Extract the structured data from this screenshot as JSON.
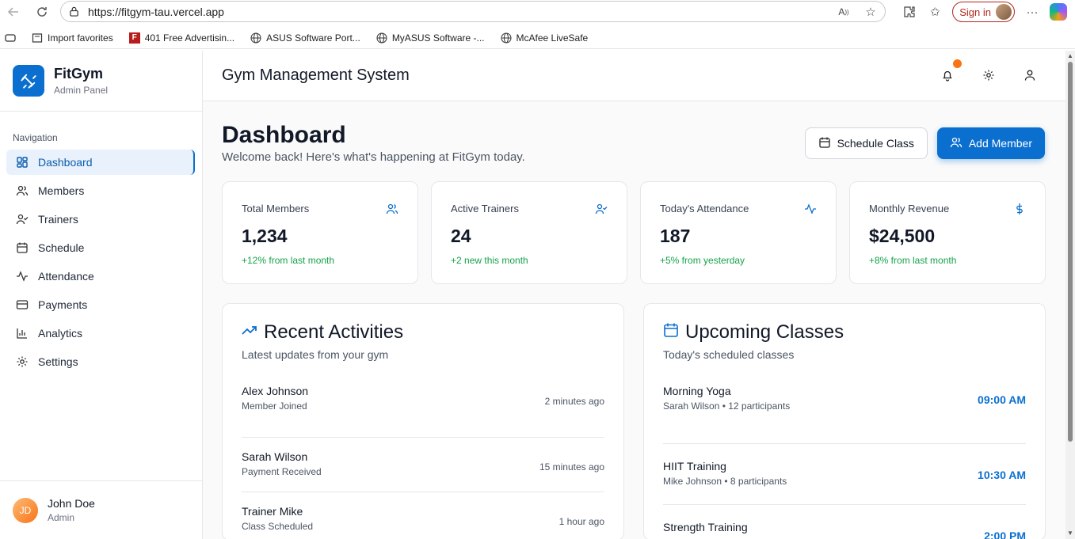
{
  "browser": {
    "url": "https://fitgym-tau.vercel.app",
    "signin_label": "Sign in",
    "bookmarks": [
      {
        "label": "Import favorites",
        "icon": "folder-icon"
      },
      {
        "label": "401 Free Advertisin...",
        "icon": "f-logo-icon"
      },
      {
        "label": "ASUS Software Port...",
        "icon": "globe-icon"
      },
      {
        "label": "MyASUS Software -...",
        "icon": "globe-icon"
      },
      {
        "label": "McAfee LiveSafe",
        "icon": "globe-icon"
      }
    ]
  },
  "brand": {
    "name": "FitGym",
    "subtitle": "Admin Panel",
    "color": "#0a6fcf"
  },
  "sidebar": {
    "title": "Navigation",
    "items": [
      {
        "label": "Dashboard",
        "icon": "grid-icon",
        "active": true
      },
      {
        "label": "Members",
        "icon": "users-icon"
      },
      {
        "label": "Trainers",
        "icon": "user-check-icon"
      },
      {
        "label": "Schedule",
        "icon": "calendar-icon"
      },
      {
        "label": "Attendance",
        "icon": "activity-icon"
      },
      {
        "label": "Payments",
        "icon": "credit-card-icon"
      },
      {
        "label": "Analytics",
        "icon": "bar-chart-icon"
      },
      {
        "label": "Settings",
        "icon": "gear-icon"
      }
    ]
  },
  "user": {
    "initials": "JD",
    "name": "John Doe",
    "role": "Admin"
  },
  "topbar": {
    "title": "Gym Management System"
  },
  "page": {
    "title": "Dashboard",
    "subtitle": "Welcome back! Here's what's happening at FitGym today.",
    "schedule_button": "Schedule Class",
    "add_button": "Add Member"
  },
  "stats": [
    {
      "label": "Total Members",
      "value": "1,234",
      "change": "+12% from last month",
      "icon": "users-icon"
    },
    {
      "label": "Active Trainers",
      "value": "24",
      "change": "+2 new this month",
      "icon": "user-check-icon"
    },
    {
      "label": "Today's Attendance",
      "value": "187",
      "change": "+5% from yesterday",
      "icon": "activity-icon"
    },
    {
      "label": "Monthly Revenue",
      "value": "$24,500",
      "change": "+8% from last month",
      "icon": "dollar-icon"
    }
  ],
  "activities": {
    "title": "Recent Activities",
    "subtitle": "Latest updates from your gym",
    "items": [
      {
        "name": "Alex Johnson",
        "action": "Member Joined",
        "time": "2 minutes ago"
      },
      {
        "name": "Sarah Wilson",
        "action": "Payment Received",
        "time": "15 minutes ago"
      },
      {
        "name": "Trainer Mike",
        "action": "Class Scheduled",
        "time": "1 hour ago"
      }
    ]
  },
  "classes": {
    "title": "Upcoming Classes",
    "subtitle": "Today's scheduled classes",
    "items": [
      {
        "name": "Morning Yoga",
        "detail": "Sarah Wilson • 12 participants",
        "time": "09:00 AM"
      },
      {
        "name": "HIIT Training",
        "detail": "Mike Johnson • 8 participants",
        "time": "10:30 AM"
      },
      {
        "name": "Strength Training",
        "detail": "",
        "time": "2:00 PM"
      }
    ]
  },
  "colors": {
    "accent": "#0a6fcf",
    "positive": "#16a34a",
    "notification": "#f97316"
  }
}
